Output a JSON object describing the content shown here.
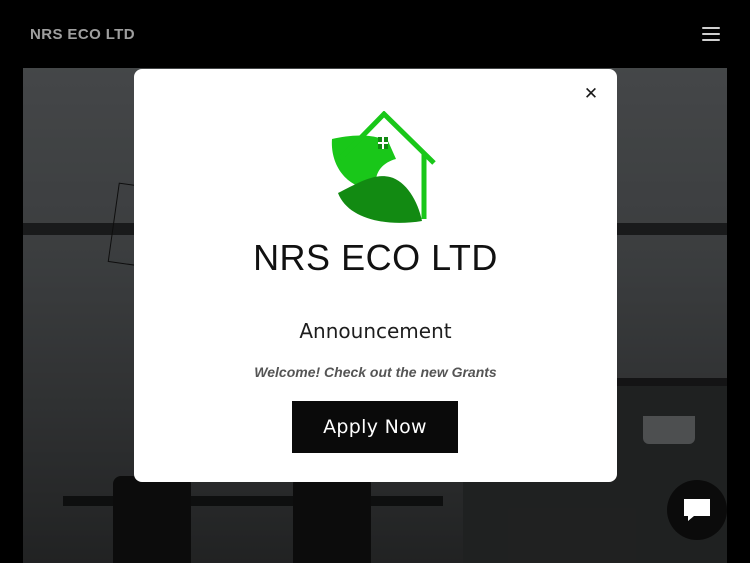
{
  "header": {
    "site_title": "NRS ECO LTD",
    "menu_icon": "hamburger-menu-icon"
  },
  "modal": {
    "close_icon": "close-icon",
    "logo_icon": "leaf-house-logo-icon",
    "brand": "NRS ECO LTD",
    "heading": "Announcement",
    "message": "Welcome! Check out the new Grants",
    "cta_label": "Apply Now"
  },
  "chat": {
    "icon": "chat-bubble-icon"
  },
  "colors": {
    "page_background": "#000000",
    "modal_background": "#ffffff",
    "button_background": "#0a0a0a",
    "logo_green_light": "#19c719",
    "logo_green_dark": "#128a12"
  }
}
